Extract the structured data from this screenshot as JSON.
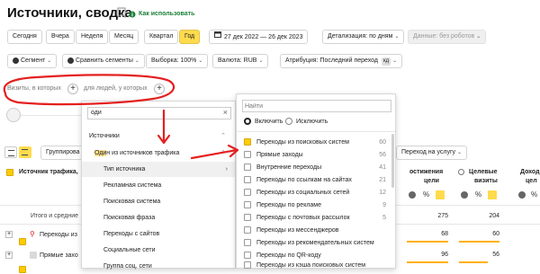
{
  "header": {
    "title": "Источники, сводка",
    "how_to_use": "Как использовать"
  },
  "periods": [
    "Сегодня",
    "Вчера",
    "Неделя",
    "Месяц",
    "Квартал",
    "Год"
  ],
  "active_period": "Год",
  "date_range": "27 дек 2022 — 26 дек 2023",
  "detail": "Детализация: по дням",
  "data_filter": "Данные: без роботов",
  "filters": {
    "segment": "Сегмент",
    "compare": "Сравнить сегменты",
    "sample": "Выборка: 100%",
    "currency": "Валюта: RUB",
    "attribution": "Атрибуция: Последний переход",
    "attribution_badge": "кд"
  },
  "visits_filter": {
    "left": "Визиты, в которых",
    "right": "для людей, у которых"
  },
  "search_left": {
    "value": "оди"
  },
  "left_menu": {
    "section": "Источники",
    "group": "Один из источников трафика",
    "group_highlight": "Оди",
    "group_rest": "н из источников трафика",
    "items": [
      "Тип источника",
      "Рекламная система",
      "Поисковая система",
      "Поисковая фраза",
      "Переходы с сайтов",
      "Социальные сети",
      "Группа соц. сети"
    ]
  },
  "right_panel": {
    "search_placeholder": "Найти",
    "include": "Включить",
    "exclude": "Исключить",
    "items": [
      {
        "label": "Переходы из поисковых систем",
        "count": "60",
        "checked": true
      },
      {
        "label": "Прямые заходы",
        "count": "56",
        "checked": false
      },
      {
        "label": "Внутренние переходы",
        "count": "41",
        "checked": false
      },
      {
        "label": "Переходы по ссылкам на сайтах",
        "count": "21",
        "checked": false
      },
      {
        "label": "Переходы из социальных сетей",
        "count": "12",
        "checked": false
      },
      {
        "label": "Переходы по рекламе",
        "count": "9",
        "checked": false
      },
      {
        "label": "Переходы с почтовых рассылок",
        "count": "5",
        "checked": false
      },
      {
        "label": "Переходы из мессенджеров",
        "count": "",
        "checked": false
      },
      {
        "label": "Переходы из рекомендательных систем",
        "count": "",
        "checked": false
      },
      {
        "label": "Переходы по QR-коду",
        "count": "",
        "checked": false
      },
      {
        "label": "Переходы из кэша поисковых систем",
        "count": "",
        "checked": false
      }
    ]
  },
  "toolbar": {
    "group": "Группирова",
    "goal": "Переход на услугу"
  },
  "table": {
    "col_source": "Источник трафика, ",
    "col_reach_1": "остижения",
    "col_reach_2": "цели",
    "col_target_1": "Целевые",
    "col_target_2": "визиты",
    "col_income_1": "Доход",
    "col_income_2": "цел",
    "rows": [
      {
        "label": "Итого и средние",
        "reach": "275",
        "target": "204"
      },
      {
        "label": "Переходы из",
        "reach": "68",
        "target": "60"
      },
      {
        "label": "Прямые захо",
        "reach": "96",
        "target": "56"
      }
    ]
  },
  "colors": {
    "accent": "#ffdb4d",
    "link_green": "#1a7f37",
    "annotation_red": "#e4201f"
  }
}
